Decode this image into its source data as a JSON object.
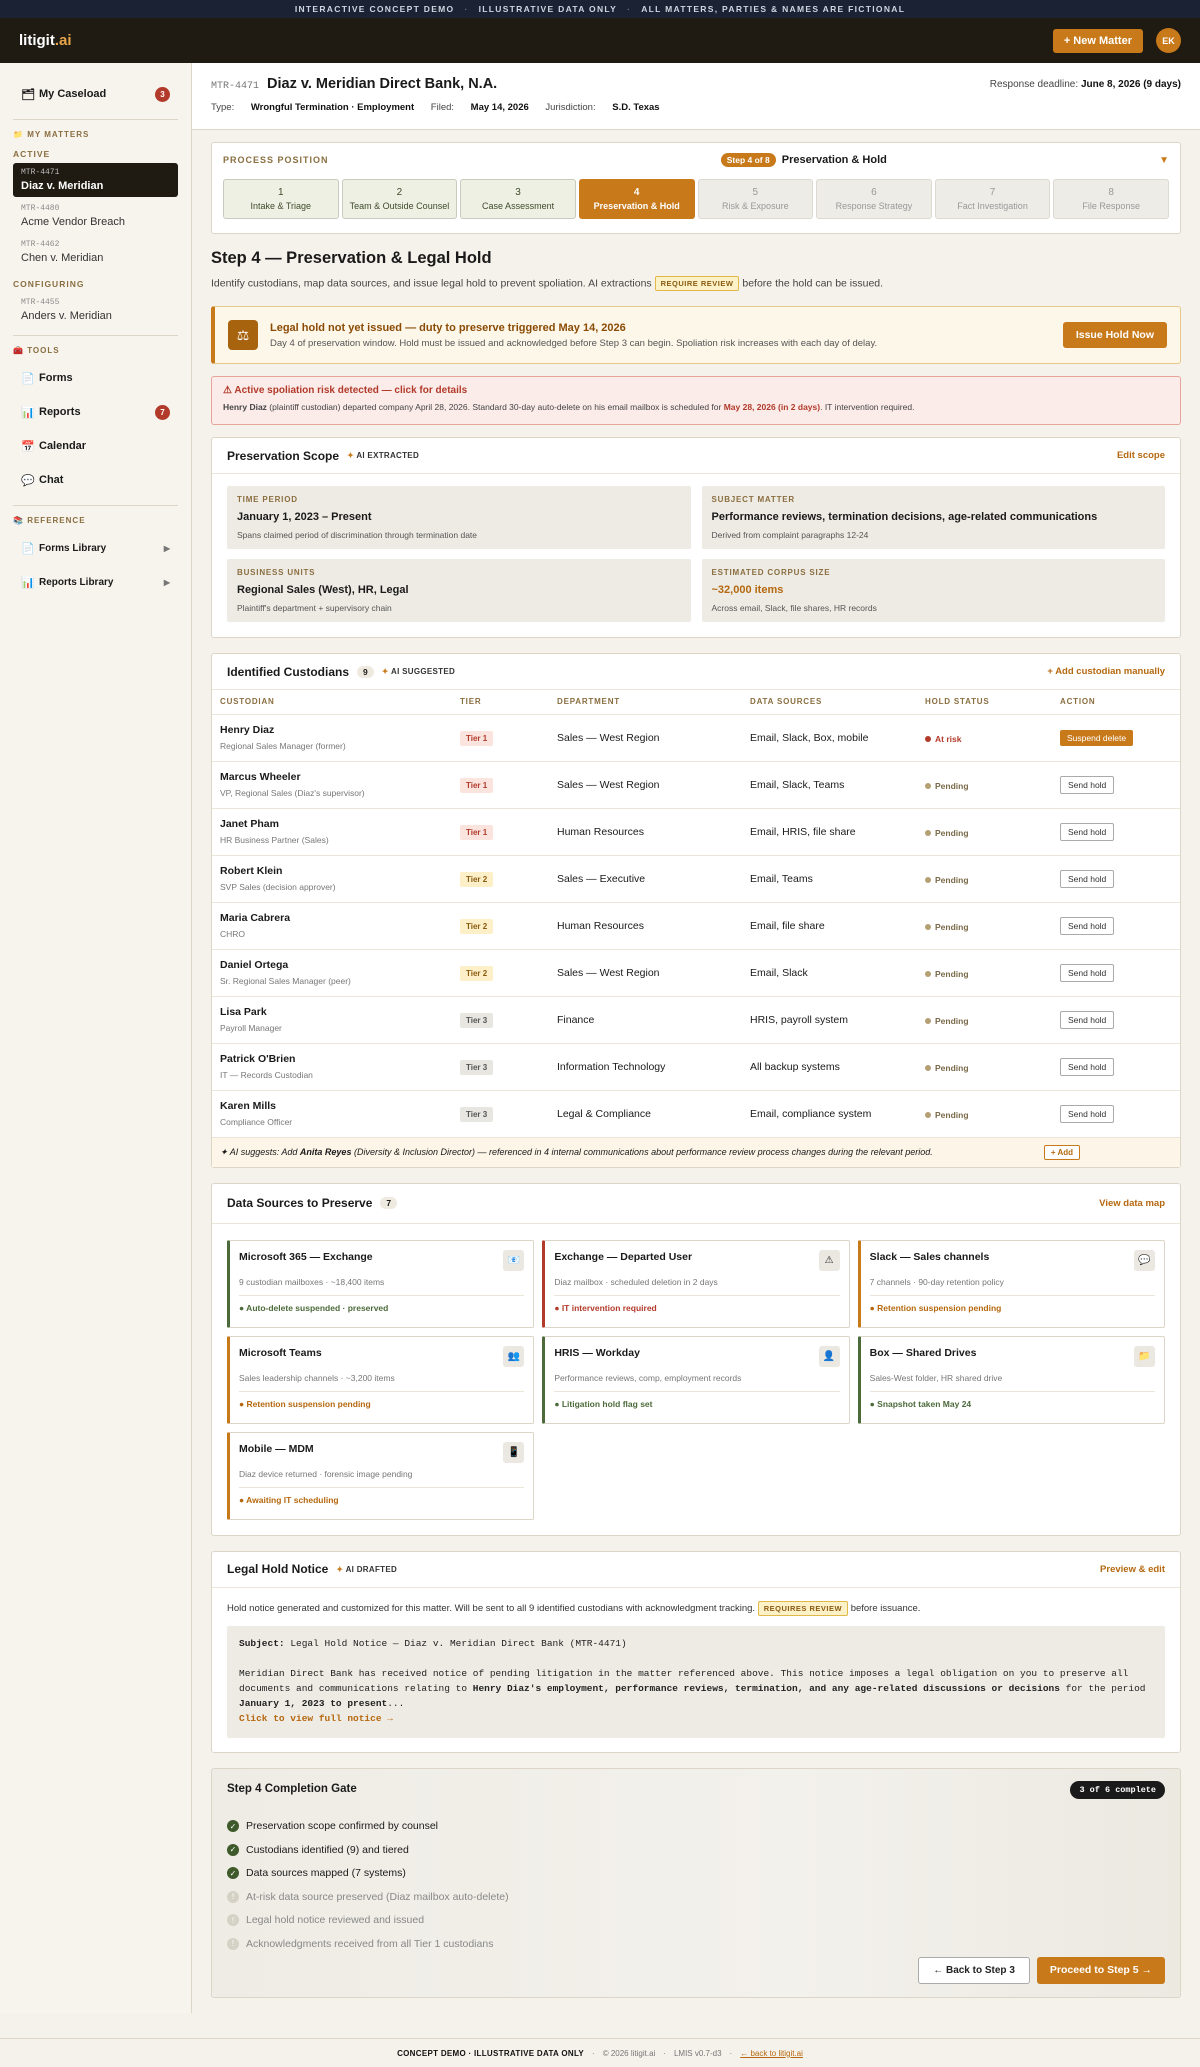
{
  "banner": [
    "INTERACTIVE CONCEPT DEMO",
    "ILLUSTRATIVE DATA ONLY",
    "ALL MATTERS, PARTIES & NAMES ARE FICTIONAL"
  ],
  "topbar": {
    "logo_main": "litigit",
    "logo_accent": ".ai",
    "new_matter": "+ New Matter",
    "avatar": "EK"
  },
  "sidebar": {
    "caseload": {
      "label": "My Caseload",
      "count": "3"
    },
    "my_matters": "MY MATTERS",
    "active_label": "ACTIVE",
    "matters_active": [
      {
        "id": "MTR-4471",
        "name": "Diaz v. Meridian"
      },
      {
        "id": "MTR-4480",
        "name": "Acme Vendor Breach"
      },
      {
        "id": "MTR-4462",
        "name": "Chen v. Meridian"
      }
    ],
    "configuring_label": "CONFIGURING",
    "matters_config": [
      {
        "id": "MTR-4455",
        "name": "Anders v. Meridian"
      }
    ],
    "tools_label": "TOOLS",
    "tools": [
      {
        "label": "Forms"
      },
      {
        "label": "Reports",
        "count": "7"
      },
      {
        "label": "Calendar"
      },
      {
        "label": "Chat"
      }
    ],
    "reference_label": "REFERENCE",
    "reference": [
      {
        "label": "Forms Library"
      },
      {
        "label": "Reports Library"
      }
    ]
  },
  "header": {
    "id": "MTR-4471",
    "title": "Diaz v. Meridian Direct Bank, N.A.",
    "type_k": "Type:",
    "type_v": "Wrongful Termination · Employment",
    "filed_k": "Filed:",
    "filed_v": "May 14, 2026",
    "jur_k": "Jurisdiction:",
    "jur_v": "S.D. Texas",
    "deadline_k": "Response deadline:",
    "deadline_v": "June 8, 2026 (9 days)"
  },
  "process": {
    "label": "PROCESS POSITION",
    "badge": "Step 4 of 8",
    "current": "Preservation & Hold",
    "steps": [
      {
        "n": "1",
        "label": "Intake & Triage"
      },
      {
        "n": "2",
        "label": "Team & Outside Counsel"
      },
      {
        "n": "3",
        "label": "Case Assessment"
      },
      {
        "n": "4",
        "label": "Preservation & Hold"
      },
      {
        "n": "5",
        "label": "Risk & Exposure"
      },
      {
        "n": "6",
        "label": "Response Strategy"
      },
      {
        "n": "7",
        "label": "Fact Investigation"
      },
      {
        "n": "8",
        "label": "File Response"
      }
    ]
  },
  "step": {
    "title": "Step 4 — Preservation & Legal Hold",
    "lede_a": "Identify custodians, map data sources, and issue legal hold to prevent spoliation. AI extractions",
    "lede_pill": "REQUIRE REVIEW",
    "lede_b": "before the hold can be issued."
  },
  "alert": {
    "title": "Legal hold not yet issued — duty to preserve triggered May 14, 2026",
    "body": "Day 4 of preservation window. Hold must be issued and acknowledged before Step 3 can begin. Spoliation risk increases with each day of delay.",
    "button": "Issue Hold Now"
  },
  "risk": {
    "title": "⚠ Active spoliation risk detected — click for details",
    "name": "Henry Diaz",
    "body_a": " (plaintiff custodian) departed company April 28, 2026. Standard 30-day auto-delete on his email mailbox is scheduled for ",
    "date": "May 28, 2026 (in 2 days)",
    "body_b": ". IT intervention required."
  },
  "scope": {
    "title": "Preservation Scope",
    "tag": "AI EXTRACTED",
    "link": "Edit scope",
    "boxes": [
      {
        "k": "TIME PERIOD",
        "v": "January 1, 2023 – Present",
        "s": "Spans claimed period of discrimination through termination date"
      },
      {
        "k": "SUBJECT MATTER",
        "v": "Performance reviews, termination decisions, age-related communications",
        "s": "Derived from complaint paragraphs 12-24"
      },
      {
        "k": "BUSINESS UNITS",
        "v": "Regional Sales (West), HR, Legal",
        "s": "Plaintiff's department + supervisory chain"
      },
      {
        "k": "ESTIMATED CORPUS SIZE",
        "v": "~32,000 items",
        "s": "Across email, Slack, file shares, HR records"
      }
    ]
  },
  "custodians": {
    "title": "Identified Custodians",
    "count": "9",
    "tag": "AI SUGGESTED",
    "link": "+ Add custodian manually",
    "cols": [
      "CUSTODIAN",
      "TIER",
      "DEPARTMENT",
      "DATA SOURCES",
      "HOLD STATUS",
      "ACTION"
    ],
    "rows": [
      {
        "name": "Henry Diaz",
        "role": "Regional Sales Manager (former)",
        "tier": "Tier 1",
        "dept": "Sales — West Region",
        "src": "Email, Slack, Box, mobile",
        "status": "At risk",
        "action": "Suspend delete"
      },
      {
        "name": "Marcus Wheeler",
        "role": "VP, Regional Sales (Diaz's supervisor)",
        "tier": "Tier 1",
        "dept": "Sales — West Region",
        "src": "Email, Slack, Teams",
        "status": "Pending",
        "action": "Send hold"
      },
      {
        "name": "Janet Pham",
        "role": "HR Business Partner (Sales)",
        "tier": "Tier 1",
        "dept": "Human Resources",
        "src": "Email, HRIS, file share",
        "status": "Pending",
        "action": "Send hold"
      },
      {
        "name": "Robert Klein",
        "role": "SVP Sales (decision approver)",
        "tier": "Tier 2",
        "dept": "Sales — Executive",
        "src": "Email, Teams",
        "status": "Pending",
        "action": "Send hold"
      },
      {
        "name": "Maria Cabrera",
        "role": "CHRO",
        "tier": "Tier 2",
        "dept": "Human Resources",
        "src": "Email, file share",
        "status": "Pending",
        "action": "Send hold"
      },
      {
        "name": "Daniel Ortega",
        "role": "Sr. Regional Sales Manager (peer)",
        "tier": "Tier 2",
        "dept": "Sales — West Region",
        "src": "Email, Slack",
        "status": "Pending",
        "action": "Send hold"
      },
      {
        "name": "Lisa Park",
        "role": "Payroll Manager",
        "tier": "Tier 3",
        "dept": "Finance",
        "src": "HRIS, payroll system",
        "status": "Pending",
        "action": "Send hold"
      },
      {
        "name": "Patrick O'Brien",
        "role": "IT — Records Custodian",
        "tier": "Tier 3",
        "dept": "Information Technology",
        "src": "All backup systems",
        "status": "Pending",
        "action": "Send hold"
      },
      {
        "name": "Karen Mills",
        "role": "Compliance Officer",
        "tier": "Tier 3",
        "dept": "Legal & Compliance",
        "src": "Email, compliance system",
        "status": "Pending",
        "action": "Send hold"
      }
    ],
    "suggest_a": "✦ AI suggests: Add ",
    "suggest_name": "Anita Reyes",
    "suggest_b": " (Diversity & Inclusion Director) — referenced in 4 internal communications about performance review process changes during the relevant period.",
    "suggest_btn": "+ Add"
  },
  "sources": {
    "title": "Data Sources to Preserve",
    "count": "7",
    "link": "View data map",
    "items": [
      {
        "title": "Microsoft 365 — Exchange",
        "sub": "9 custodian mailboxes · ~18,400 items",
        "status": "● Auto-delete suspended · preserved",
        "icon": "📧"
      },
      {
        "title": "Exchange — Departed User",
        "sub": "Diaz mailbox · scheduled deletion in 2 days",
        "status": "● IT intervention required",
        "icon": "⚠"
      },
      {
        "title": "Slack — Sales channels",
        "sub": "7 channels · 90-day retention policy",
        "status": "● Retention suspension pending",
        "icon": "💬"
      },
      {
        "title": "Microsoft Teams",
        "sub": "Sales leadership channels · ~3,200 items",
        "status": "● Retention suspension pending",
        "icon": "👥"
      },
      {
        "title": "HRIS — Workday",
        "sub": "Performance reviews, comp, employment records",
        "status": "● Litigation hold flag set",
        "icon": "👤"
      },
      {
        "title": "Box — Shared Drives",
        "sub": "Sales-West folder, HR shared drive",
        "status": "● Snapshot taken May 24",
        "icon": "📁"
      },
      {
        "title": "Mobile — MDM",
        "sub": "Diaz device returned · forensic image pending",
        "status": "● Awaiting IT scheduling",
        "icon": "📱"
      }
    ]
  },
  "notice": {
    "title": "Legal Hold Notice",
    "tag": "AI DRAFTED",
    "link": "Preview & edit",
    "intro_a": "Hold notice generated and customized for this matter. Will be sent to all 9 identified custodians with acknowledgment tracking.",
    "intro_pill": "REQUIRES REVIEW",
    "intro_b": "before issuance.",
    "subj_k": "Subject:",
    "subj_v": "Legal Hold Notice — Diaz v. Meridian Direct Bank (MTR-4471)",
    "body_a": "Meridian Direct Bank has received notice of pending litigation in the matter referenced above. This notice imposes a legal obligation on you to preserve all documents and communications relating to ",
    "body_bold": "Henry Diaz's employment, performance reviews, termination, and any age-related discussions or decisions",
    "body_b": " for the period ",
    "body_bold2": "January 1, 2023 to present",
    "body_c": "...",
    "link2": "Click to view full notice →"
  },
  "gate": {
    "title": "Step 4 Completion Gate",
    "progress": "3 of 6 complete",
    "items": [
      {
        "label": "Preservation scope confirmed by counsel",
        "done": true
      },
      {
        "label": "Custodians identified (9) and tiered",
        "done": true
      },
      {
        "label": "Data sources mapped (7 systems)",
        "done": true
      },
      {
        "label": "At-risk data source preserved (Diaz mailbox auto-delete)",
        "done": false
      },
      {
        "label": "Legal hold notice reviewed and issued",
        "done": false
      },
      {
        "label": "Acknowledgments received from all Tier 1 custodians",
        "done": false
      }
    ],
    "back": "← Back to Step 3",
    "next": "Proceed to Step 5 →"
  },
  "footer": {
    "a": "CONCEPT DEMO · ILLUSTRATIVE DATA ONLY",
    "b": "© 2026 litigit.ai",
    "c": "LMIS v0.7-d3",
    "d": "← back to litigit.ai"
  }
}
